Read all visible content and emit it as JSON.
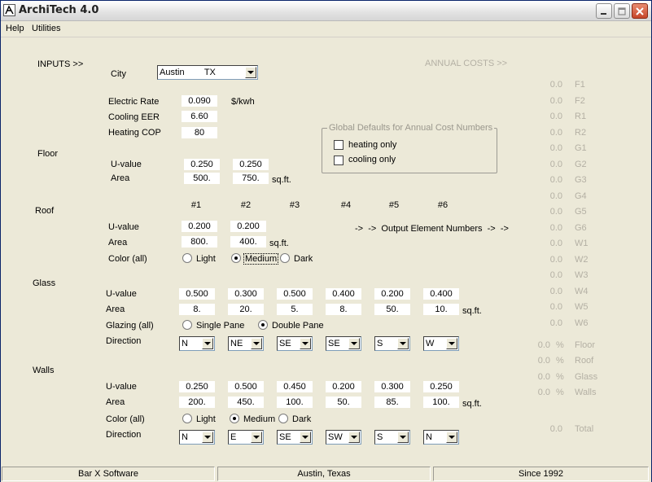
{
  "window": {
    "title": "ArchiTech 4.0"
  },
  "menu": [
    "Help",
    "Utilities"
  ],
  "inputs": {
    "heading": "INPUTS >>",
    "city_label": "City",
    "city_value": "Austin        TX",
    "electric_rate_label": "Electric Rate",
    "electric_rate": "0.090",
    "electric_rate_unit": "$/kwh",
    "cooling_eer_label": "Cooling EER",
    "cooling_eer": "6.60",
    "heating_cop_label": "Heating COP",
    "heating_cop": "80"
  },
  "global_defaults": {
    "legend": "Global Defaults for Annual Cost Numbers",
    "heating_only": "heating only",
    "cooling_only": "cooling only"
  },
  "floor": {
    "section": "Floor",
    "u_label": "U-value",
    "area_label": "Area",
    "u_values": [
      "0.250",
      "0.250"
    ],
    "areas": [
      "500.",
      "750."
    ],
    "unit": "sq.ft."
  },
  "columns": [
    "#1",
    "#2",
    "#3",
    "#4",
    "#5",
    "#6"
  ],
  "roof": {
    "section": "Roof",
    "u_label": "U-value",
    "area_label": "Area",
    "color_label": "Color (all)",
    "u_values": [
      "0.200",
      "0.200"
    ],
    "areas": [
      "800.",
      "400."
    ],
    "unit": "sq.ft.",
    "colors": [
      "Light",
      "Medium",
      "Dark"
    ],
    "selected_color": "Medium",
    "output_note": "->  ->  Output Element Numbers  ->  ->"
  },
  "glass": {
    "section": "Glass",
    "u_label": "U-value",
    "area_label": "Area",
    "glazing_label": "Glazing (all)",
    "direction_label": "Direction",
    "u_values": [
      "0.500",
      "0.300",
      "0.500",
      "0.400",
      "0.200",
      "0.400"
    ],
    "areas": [
      "8.",
      "20.",
      "5.",
      "8.",
      "50.",
      "10."
    ],
    "unit": "sq.ft.",
    "glazing": [
      "Single Pane",
      "Double Pane"
    ],
    "selected_glazing": "Double Pane",
    "directions": [
      "N",
      "NE",
      "SE",
      "SE",
      "S",
      "W"
    ]
  },
  "walls": {
    "section": "Walls",
    "u_label": "U-value",
    "area_label": "Area",
    "color_label": "Color (all)",
    "direction_label": "Direction",
    "u_values": [
      "0.250",
      "0.500",
      "0.450",
      "0.200",
      "0.300",
      "0.250"
    ],
    "areas": [
      "200.",
      "450.",
      "100.",
      "50.",
      "85.",
      "100."
    ],
    "unit": "sq.ft.",
    "colors": [
      "Light",
      "Medium",
      "Dark"
    ],
    "selected_color": "Medium",
    "directions": [
      "N",
      "E",
      "SE",
      "SW",
      "S",
      "N"
    ]
  },
  "annual_costs": {
    "heading": "ANNUAL COSTS >>",
    "rows": [
      {
        "value": "0.0",
        "code": "F1"
      },
      {
        "value": "0.0",
        "code": "F2"
      },
      {
        "value": "0.0",
        "code": "R1"
      },
      {
        "value": "0.0",
        "code": "R2"
      },
      {
        "value": "0.0",
        "code": "G1"
      },
      {
        "value": "0.0",
        "code": "G2"
      },
      {
        "value": "0.0",
        "code": "G3"
      },
      {
        "value": "0.0",
        "code": "G4"
      },
      {
        "value": "0.0",
        "code": "G5"
      },
      {
        "value": "0.0",
        "code": "G6"
      },
      {
        "value": "0.0",
        "code": "W1"
      },
      {
        "value": "0.0",
        "code": "W2"
      },
      {
        "value": "0.0",
        "code": "W3"
      },
      {
        "value": "0.0",
        "code": "W4"
      },
      {
        "value": "0.0",
        "code": "W5"
      },
      {
        "value": "0.0",
        "code": "W6"
      }
    ],
    "pct": [
      {
        "value": "0.0",
        "unit": "%",
        "label": "Floor"
      },
      {
        "value": "0.0",
        "unit": "%",
        "label": "Roof"
      },
      {
        "value": "0.0",
        "unit": "%",
        "label": "Glass"
      },
      {
        "value": "0.0",
        "unit": "%",
        "label": "Walls"
      }
    ],
    "total": {
      "value": "0.0",
      "label": "Total"
    }
  },
  "statusbar": [
    "Bar X Software",
    "Austin, Texas",
    "Since 1992"
  ],
  "colors": {
    "title_bar": "#e4e4e4",
    "face": "#ece9d8",
    "disabled_text": "#b4b0a4",
    "close_button": "#c6462a"
  }
}
